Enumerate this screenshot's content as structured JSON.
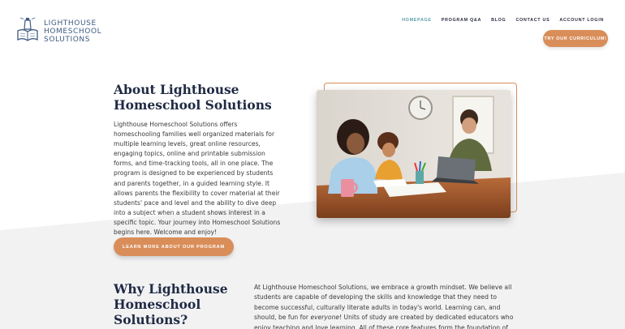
{
  "logo": {
    "line1": "LIGHTHOUSE",
    "line2": "HOMESCHOOL",
    "line3": "SOLUTIONS",
    "icon": "lighthouse-book-icon"
  },
  "nav": {
    "items": [
      {
        "label": "HOMEPAGE",
        "active": true
      },
      {
        "label": "PROGRAM Q&A",
        "active": false
      },
      {
        "label": "BLOG",
        "active": false
      },
      {
        "label": "CONTACT US",
        "active": false
      },
      {
        "label": "ACCOUNT LOGIN",
        "active": false
      }
    ],
    "cta": "TRY OUR CURRICULUM!"
  },
  "about": {
    "title": "About Lighthouse Homeschool Solutions",
    "body": "Lighthouse Homeschool Solutions offers homeschooling families well organized materials for multiple learning levels, great online resources, engaging topics, online and printable submission forms, and time-tracking tools, all in one place. The program is designed to be experienced by students and parents together, in a guided learning style. It allows parents the flexibility to cover material at their students' pace and level and the ability to dive deep into a subject when a student shows interest in a specific topic. Your journey into Homeschool Solutions begins here. Welcome and enjoy!",
    "button": "LEARN MORE ABOUT OUR PROGRAM",
    "photo": "family-homeschool-photo"
  },
  "why": {
    "title": "Why Lighthouse Homeschool Solutions?",
    "body_part1": "At Lighthouse Homeschool Solutions, we embrace a growth mindset. We believe all students are capable of developing the skills and knowledge that they need to become successful, culturally literate adults in today's world. Learning can, and should, be fun for ",
    "body_em": "everyone",
    "body_part2": "! Units of study are created by dedicated educators who enjoy teaching and love learning. All of these core features form the foundation of the Lighthouse Homeschool"
  },
  "colors": {
    "accent": "#d98e5a",
    "nav_active": "#5b9ea6",
    "heading": "#1f2a44",
    "section_bg": "#f2f2f3"
  }
}
